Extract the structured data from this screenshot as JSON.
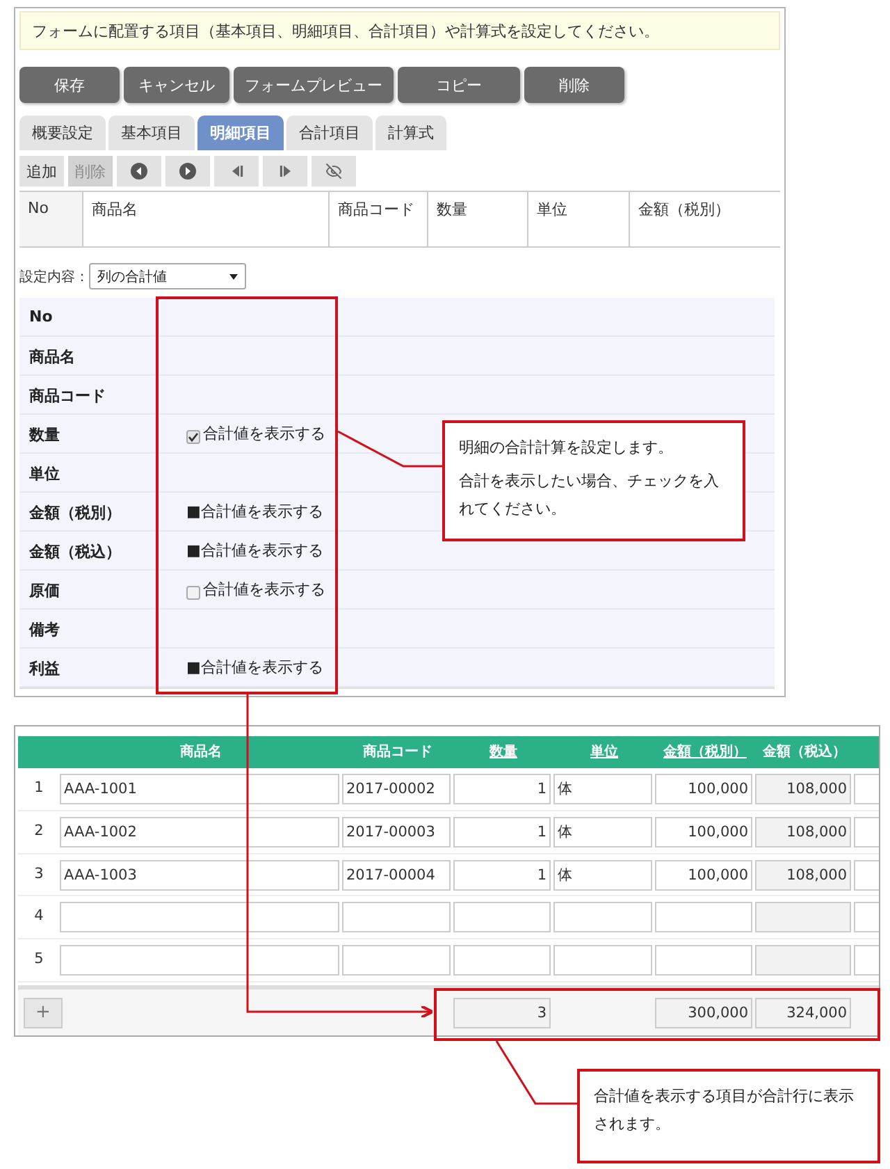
{
  "notice": "フォームに配置する項目（基本項目、明細項目、合計項目）や計算式を設定してください。",
  "actions": [
    {
      "label": "保存"
    },
    {
      "label": "キャンセル"
    },
    {
      "label": "フォームプレビュー"
    },
    {
      "label": "コピー"
    },
    {
      "label": "削除"
    }
  ],
  "tabs": [
    {
      "label": "概要設定",
      "selected": false
    },
    {
      "label": "基本項目",
      "selected": false
    },
    {
      "label": "明細項目",
      "selected": true
    },
    {
      "label": "合計項目",
      "selected": false
    },
    {
      "label": "計算式",
      "selected": false
    }
  ],
  "toolbar": [
    {
      "label": "追加",
      "disabled": false
    },
    {
      "label": "削除",
      "disabled": true
    }
  ],
  "header_columns": [
    "No",
    "商品名",
    "商品コード",
    "数量",
    "単位",
    "金額（税別）"
  ],
  "setting": {
    "label": "設定内容：",
    "value": "列の合計値"
  },
  "fields": [
    {
      "name": "No"
    },
    {
      "name": "商品名"
    },
    {
      "name": "商品コード"
    },
    {
      "name": "数量",
      "option": {
        "kind": "checkbox",
        "checked": true,
        "label": "合計値を表示する"
      }
    },
    {
      "name": "単位"
    },
    {
      "name": "金額（税別）",
      "option": {
        "kind": "mark",
        "label": "■合計値を表示する"
      }
    },
    {
      "name": "金額（税込）",
      "option": {
        "kind": "mark",
        "label": "■合計値を表示する"
      }
    },
    {
      "name": "原価",
      "option": {
        "kind": "checkbox",
        "checked": false,
        "label": "合計値を表示する"
      }
    },
    {
      "name": "備考"
    },
    {
      "name": "利益",
      "option": {
        "kind": "mark",
        "label": "■合計値を表示する"
      }
    }
  ],
  "callouts": [
    {
      "paragraphs": [
        "明細の合計計算を設定します。",
        "合計を表示したい場合、チェックを入れてください。"
      ]
    },
    {
      "paragraphs": [
        "合計値を表示する項目が合計行に表示されます。"
      ]
    }
  ],
  "detail": {
    "columns": [
      {
        "label": "商品名",
        "link": false
      },
      {
        "label": "商品コード",
        "link": false
      },
      {
        "label": "数量",
        "link": true
      },
      {
        "label": "単位",
        "link": true
      },
      {
        "label": "金額（税別）",
        "link": true
      },
      {
        "label": "金額（税込）",
        "link": false
      }
    ],
    "rows": [
      {
        "no": "1",
        "cells": [
          {
            "value": "AAA-1001",
            "readonly": false
          },
          {
            "value": "2017-00002",
            "readonly": false
          },
          {
            "value": "1",
            "readonly": false
          },
          {
            "value": "体",
            "readonly": false
          },
          {
            "value": "100,000",
            "readonly": false
          },
          {
            "value": "108,000",
            "readonly": true
          },
          {
            "readonly": false
          }
        ]
      },
      {
        "no": "2",
        "cells": [
          {
            "value": "AAA-1002",
            "readonly": false
          },
          {
            "value": "2017-00003",
            "readonly": false
          },
          {
            "value": "1",
            "readonly": false
          },
          {
            "value": "体",
            "readonly": false
          },
          {
            "value": "100,000",
            "readonly": false
          },
          {
            "value": "108,000",
            "readonly": true
          },
          {
            "readonly": false
          }
        ]
      },
      {
        "no": "3",
        "cells": [
          {
            "value": "AAA-1003",
            "readonly": false
          },
          {
            "value": "2017-00004",
            "readonly": false
          },
          {
            "value": "1",
            "readonly": false
          },
          {
            "value": "体",
            "readonly": false
          },
          {
            "value": "100,000",
            "readonly": false
          },
          {
            "value": "108,000",
            "readonly": true
          },
          {
            "readonly": false
          }
        ]
      },
      {
        "no": "4",
        "cells": [
          {
            "readonly": false
          },
          {
            "readonly": false
          },
          {
            "readonly": false
          },
          {
            "readonly": false
          },
          {
            "readonly": false
          },
          {
            "readonly": true
          },
          {
            "readonly": false
          }
        ]
      },
      {
        "no": "5",
        "cells": [
          {
            "readonly": false
          },
          {
            "readonly": false
          },
          {
            "readonly": false
          },
          {
            "readonly": false
          },
          {
            "readonly": false
          },
          {
            "readonly": true
          },
          {
            "readonly": false
          }
        ]
      }
    ],
    "add_button": "+",
    "totals_row": [
      {
        "kind": "blank"
      },
      {
        "kind": "blank"
      },
      {
        "kind": "total",
        "value": "3"
      },
      {
        "kind": "blank"
      },
      {
        "kind": "total",
        "value": "300,000"
      },
      {
        "kind": "total",
        "value": "324,000"
      }
    ]
  }
}
